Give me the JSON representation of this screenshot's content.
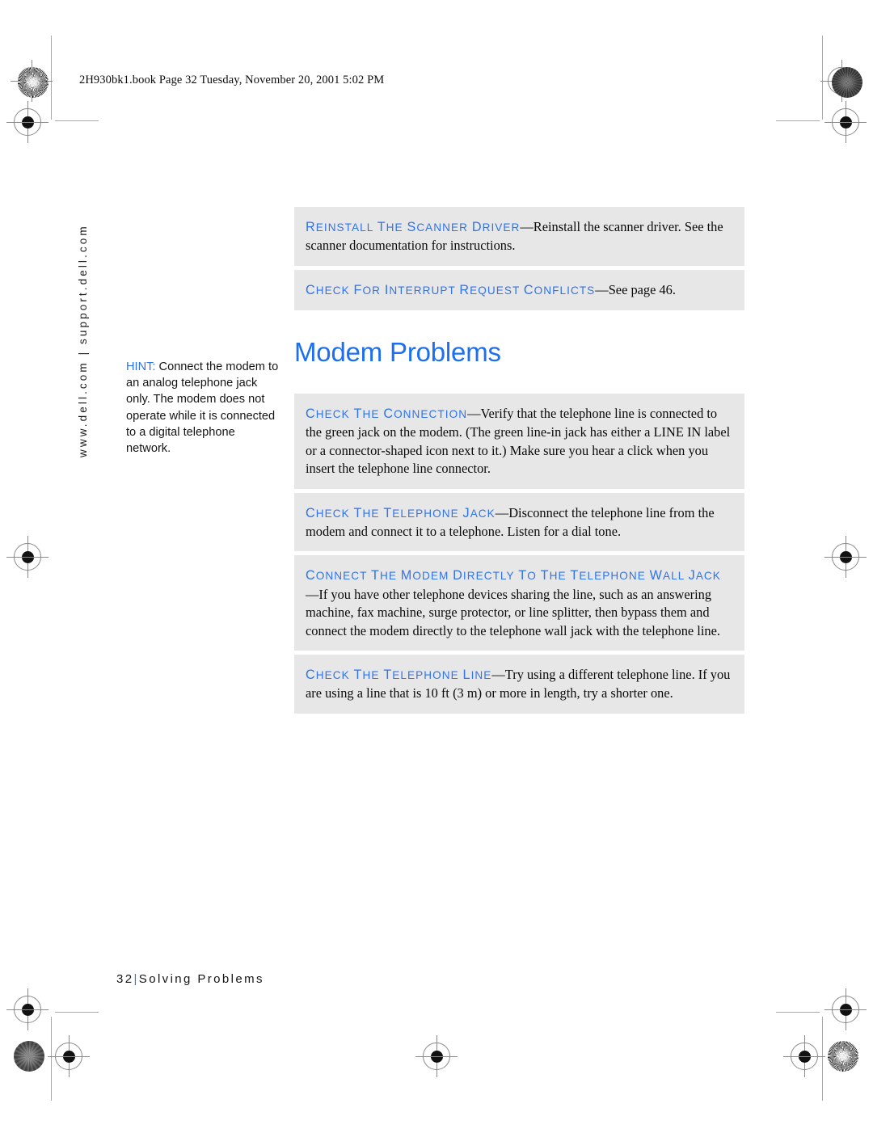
{
  "page_header": "2H930bk1.book  Page 32  Tuesday, November 20, 2001  5:02 PM",
  "side_url": "www.dell.com | support.dell.com",
  "section_title": "Modem Problems",
  "hint": {
    "keyword": "HINT:",
    "text": " Connect the modem to an analog telephone jack only. The modem does not operate while it is connected to a digital telephone network."
  },
  "top_boxes": [
    {
      "lead": "Reinstall the scanner driver",
      "dash": "—",
      "body": "Reinstall the scanner driver. See the scanner documentation for instructions."
    },
    {
      "lead": "Check for interrupt request conflicts",
      "dash": "—",
      "body": "See page 46."
    }
  ],
  "main_boxes": [
    {
      "lead": "Check the connection",
      "dash": "—",
      "body": "Verify that the telephone line is connected to the green jack on the modem. (The green line-in jack has either a LINE IN label or a connector-shaped icon next to it.) Make sure you hear a click when you insert the telephone line connector."
    },
    {
      "lead": "Check the telephone jack",
      "dash": "—",
      "body": "Disconnect the telephone line from the modem and connect it to a telephone. Listen for a dial tone."
    },
    {
      "lead": "Connect the modem directly to the telephone wall jack",
      "dash": "—",
      "body": "If you have other telephone devices sharing the line, such as an answering machine, fax machine, surge protector, or line splitter, then bypass them and connect the modem directly to the telephone wall jack with the telephone line."
    },
    {
      "lead": "Check the telephone line",
      "dash": "—",
      "body": "Try using a different telephone line. If you are using a line that is 10 ft (3 m) or more in length, try a shorter one."
    }
  ],
  "footer": {
    "page_number": "32",
    "separator": "|",
    "chapter": "Solving Problems"
  },
  "colors": {
    "accent_blue": "#2f74e8",
    "title_blue": "#1b6ff0",
    "box_gray": "#e7e7e7",
    "body_black": "#0a0a0a"
  },
  "print_marks": {
    "registration_label": "registration-target",
    "rosette_label": "color-rosette-patch",
    "density_label": "density-patch"
  }
}
